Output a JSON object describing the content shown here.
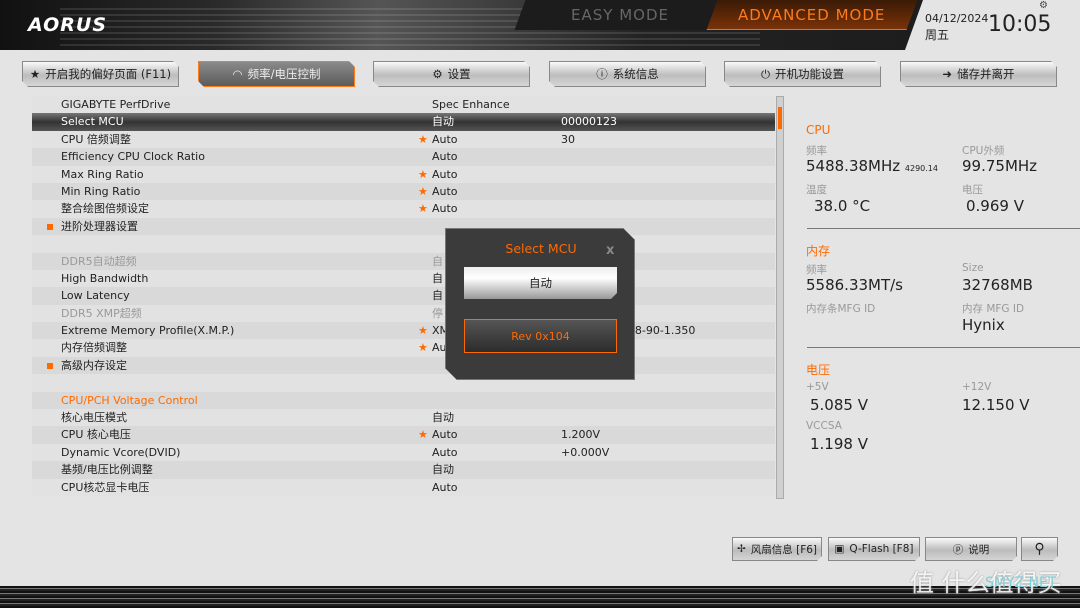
{
  "header": {
    "logo": "AORUS",
    "easy_mode": "EASY MODE",
    "advanced_mode": "ADVANCED MODE",
    "date": "04/12/2024",
    "weekday": "周五",
    "time": "10:05"
  },
  "tabs": [
    {
      "label": "开启我的偏好页面 (F11)",
      "icon": "star-icon"
    },
    {
      "label": "频率/电压控制",
      "icon": "gauge-icon",
      "active": true
    },
    {
      "label": "设置",
      "icon": "gear-icon"
    },
    {
      "label": "系统信息",
      "icon": "info-icon"
    },
    {
      "label": "开机功能设置",
      "icon": "power-icon"
    },
    {
      "label": "储存并离开",
      "icon": "exit-icon"
    }
  ],
  "rows": [
    {
      "name": "GIGABYTE PerfDrive",
      "value": "Spec Enhance",
      "extra": ""
    },
    {
      "name": "Select MCU",
      "value": "自动",
      "extra": "00000123",
      "selected": true
    },
    {
      "name": "CPU 倍频调整",
      "value": "Auto",
      "extra": "30",
      "star": true
    },
    {
      "name": "Efficiency CPU Clock Ratio",
      "value": "Auto",
      "extra": ""
    },
    {
      "name": "Max Ring Ratio",
      "value": "Auto",
      "extra": "",
      "star": true
    },
    {
      "name": "Min Ring Ratio",
      "value": "Auto",
      "extra": "",
      "star": true
    },
    {
      "name": "整合绘图倍频设定",
      "value": "Auto",
      "extra": "",
      "star": true
    },
    {
      "name": "进阶处理器设置",
      "value": "",
      "extra": "",
      "bullet": true
    },
    {
      "name": "",
      "value": "",
      "extra": ""
    },
    {
      "name": "DDR5自动超频",
      "value": "自",
      "extra": "",
      "dim": true
    },
    {
      "name": "High Bandwidth",
      "value": "自",
      "extra": ""
    },
    {
      "name": "Low Latency",
      "value": "自",
      "extra": ""
    },
    {
      "name": "DDR5 XMP超频",
      "value": "停",
      "extra": "",
      "dim": true
    },
    {
      "name": "Extreme Memory Profile(X.M.P.)",
      "value": "XMP",
      "extra": "32-38-38-90-1.350",
      "star": true
    },
    {
      "name": "内存倍频调整",
      "value": "Auto",
      "extra": "",
      "star": true
    },
    {
      "name": "高级内存设定",
      "value": "",
      "extra": "",
      "bullet": true
    },
    {
      "name": "",
      "value": "",
      "extra": ""
    },
    {
      "name": "CPU/PCH Voltage Control",
      "value": "",
      "extra": "",
      "heading": true
    },
    {
      "name": "核心电压模式",
      "value": "自动",
      "extra": ""
    },
    {
      "name": "CPU 核心电压",
      "value": "Auto",
      "extra": "1.200V",
      "star": true
    },
    {
      "name": "Dynamic Vcore(DVID)",
      "value": "Auto",
      "extra": "+0.000V"
    },
    {
      "name": "基频/电压比例调整",
      "value": "自动",
      "extra": ""
    },
    {
      "name": "CPU核芯显卡电压",
      "value": "Auto",
      "extra": ""
    }
  ],
  "dialog": {
    "title": "Select MCU",
    "close": "x",
    "options": [
      "自动",
      "Rev 0x104"
    ]
  },
  "panel": {
    "cpu": {
      "title": "CPU",
      "freq_label": "频率",
      "freq": "5488.38MHz",
      "freq_sub": "4290.14",
      "bclk_label": "CPU外频",
      "bclk": "99.75MHz",
      "temp_label": "温度",
      "temp": "38.0 °C",
      "volt_label": "电压",
      "volt": "0.969 V"
    },
    "mem": {
      "title": "内存",
      "freq_label": "频率",
      "freq": "5586.33MT/s",
      "size_label": "Size",
      "size": "32768MB",
      "mfg_label": "内存条MFG ID",
      "mfg2_label": "内存 MFG ID",
      "mfg2": "Hynix"
    },
    "volt": {
      "title": "电压",
      "v5_label": "+5V",
      "v5": "5.085 V",
      "v12_label": "+12V",
      "v12": "12.150 V",
      "vccsa_label": "VCCSA",
      "vccsa": "1.198 V"
    }
  },
  "bottom": {
    "fan": "风扇信息 [F6]",
    "qflash": "Q-Flash [F8]",
    "help": "说明"
  },
  "watermark": {
    "text": "值 什么值得买",
    "site": "SMYZ.NET"
  },
  "colors": {
    "accent": "#ff6a00"
  }
}
